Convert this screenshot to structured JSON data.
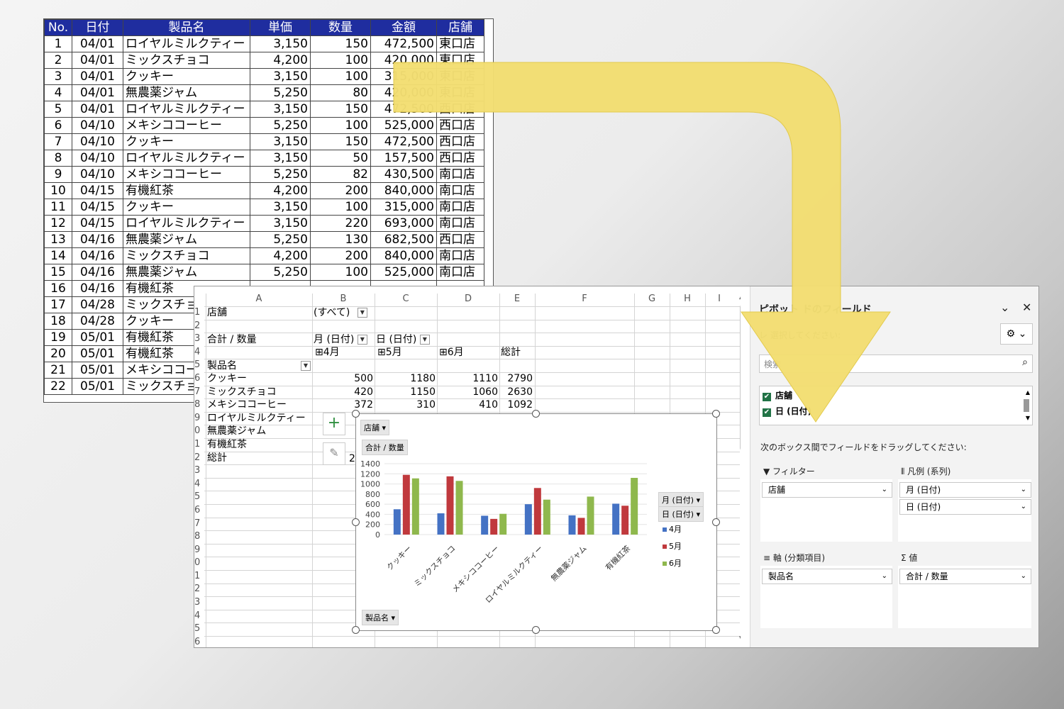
{
  "source_table": {
    "headers": [
      "No.",
      "日付",
      "製品名",
      "単価",
      "数量",
      "金額",
      "店舗"
    ],
    "rows": [
      [
        "1",
        "04/01",
        "ロイヤルミルクティー",
        "3,150",
        "150",
        "472,500",
        "東口店"
      ],
      [
        "2",
        "04/01",
        "ミックスチョコ",
        "4,200",
        "100",
        "420,000",
        "東口店"
      ],
      [
        "3",
        "04/01",
        "クッキー",
        "3,150",
        "100",
        "315,000",
        "東口店"
      ],
      [
        "4",
        "04/01",
        "無農薬ジャム",
        "5,250",
        "80",
        "420,000",
        "東口店"
      ],
      [
        "5",
        "04/01",
        "ロイヤルミルクティー",
        "3,150",
        "150",
        "472,500",
        "西口店"
      ],
      [
        "6",
        "04/10",
        "メキシココーヒー",
        "5,250",
        "100",
        "525,000",
        "西口店"
      ],
      [
        "7",
        "04/10",
        "クッキー",
        "3,150",
        "150",
        "472,500",
        "西口店"
      ],
      [
        "8",
        "04/10",
        "ロイヤルミルクティー",
        "3,150",
        "50",
        "157,500",
        "西口店"
      ],
      [
        "9",
        "04/10",
        "メキシココーヒー",
        "5,250",
        "82",
        "430,500",
        "南口店"
      ],
      [
        "10",
        "04/15",
        "有機紅茶",
        "4,200",
        "200",
        "840,000",
        "南口店"
      ],
      [
        "11",
        "04/15",
        "クッキー",
        "3,150",
        "100",
        "315,000",
        "南口店"
      ],
      [
        "12",
        "04/15",
        "ロイヤルミルクティー",
        "3,150",
        "220",
        "693,000",
        "南口店"
      ],
      [
        "13",
        "04/16",
        "無農薬ジャム",
        "5,250",
        "130",
        "682,500",
        "西口店"
      ],
      [
        "14",
        "04/16",
        "ミックスチョコ",
        "4,200",
        "200",
        "840,000",
        "南口店"
      ],
      [
        "15",
        "04/16",
        "無農薬ジャム",
        "5,250",
        "100",
        "525,000",
        "南口店"
      ],
      [
        "16",
        "04/16",
        "有機紅茶",
        "",
        "",
        "",
        ""
      ],
      [
        "17",
        "04/28",
        "ミックスチョコ",
        "",
        "",
        "",
        ""
      ],
      [
        "18",
        "04/28",
        "クッキー",
        "",
        "",
        "",
        ""
      ],
      [
        "19",
        "05/01",
        "有機紅茶",
        "",
        "",
        "",
        ""
      ],
      [
        "20",
        "05/01",
        "有機紅茶",
        "",
        "",
        "",
        ""
      ],
      [
        "21",
        "05/01",
        "メキシココー",
        "",
        "",
        "",
        ""
      ],
      [
        "22",
        "05/01",
        "ミックスチョコ",
        "",
        "",
        "",
        ""
      ]
    ]
  },
  "sheet": {
    "columns": [
      "A",
      "B",
      "C",
      "D",
      "E",
      "F",
      "G",
      "H",
      "I"
    ],
    "rows": [
      "1",
      "2",
      "3",
      "4",
      "5",
      "6",
      "7",
      "8",
      "9",
      "0",
      "1",
      "2",
      "3",
      "4",
      "5",
      "6",
      "7",
      "8",
      "9",
      "0",
      "1",
      "2",
      "3",
      "4",
      "5",
      "6"
    ],
    "filter_label": "店舗",
    "filter_value": "(すべて)",
    "sum_label": "合計 / 数量",
    "month_field": "月 (日付)",
    "day_field": "日 (日付)",
    "months": [
      "⊞4月",
      "⊞5月",
      "⊞6月"
    ],
    "grand_total_label": "総計",
    "row_field": "製品名",
    "products": [
      "クッキー",
      "ミックスチョコ",
      "メキシココーヒー",
      "ロイヤルミルクティー",
      "無農薬ジャム",
      "有機紅茶",
      "総計"
    ],
    "values": [
      [
        "500",
        "1180",
        "1110",
        "2790"
      ],
      [
        "420",
        "1150",
        "1060",
        "2630"
      ],
      [
        "372",
        "310",
        "410",
        "1092"
      ]
    ],
    "partial_total": "2"
  },
  "chart_data": {
    "type": "bar",
    "categories": [
      "クッキー",
      "ミックスチョコ",
      "メキシココーヒー",
      "ロイヤルミルクティー",
      "無農薬ジャム",
      "有機紅茶"
    ],
    "series": [
      {
        "name": "4月",
        "color": "#4472c4",
        "values": [
          500,
          420,
          372,
          600,
          380,
          610
        ]
      },
      {
        "name": "5月",
        "color": "#c0393d",
        "values": [
          1180,
          1150,
          310,
          920,
          330,
          570
        ]
      },
      {
        "name": "6月",
        "color": "#8fb84d",
        "values": [
          1110,
          1060,
          410,
          690,
          750,
          1120
        ]
      }
    ],
    "ylim": [
      0,
      1400
    ],
    "yticks": [
      "1400",
      "1200",
      "1000",
      "800",
      "600",
      "400",
      "200",
      "0"
    ],
    "chips": {
      "filter": "店舗 ▾",
      "value": "合計 / 数量",
      "axis": "製品名 ▾",
      "legend1": "月 (日付) ▾",
      "legend2": "日 (日付) ▾"
    },
    "legend_position": "right",
    "grid": true
  },
  "pivot_panel": {
    "title": "ピボット ドのフィールド",
    "instruction": "レ 選択してください:",
    "search_placeholder": "検索",
    "fields": [
      "店舗",
      "日 (日付)"
    ],
    "drag_text": "次のボックス間でフィールドをドラッグしてください:",
    "filter_area": "フィルター",
    "legend_area": "凡例 (系列)",
    "axis_area": "軸 (分類項目)",
    "values_area": "値",
    "filter_item": "店舗",
    "legend_items": [
      "月 (日付)",
      "日 (日付)"
    ],
    "axis_item": "製品名",
    "value_item": "合計 / 数量"
  }
}
